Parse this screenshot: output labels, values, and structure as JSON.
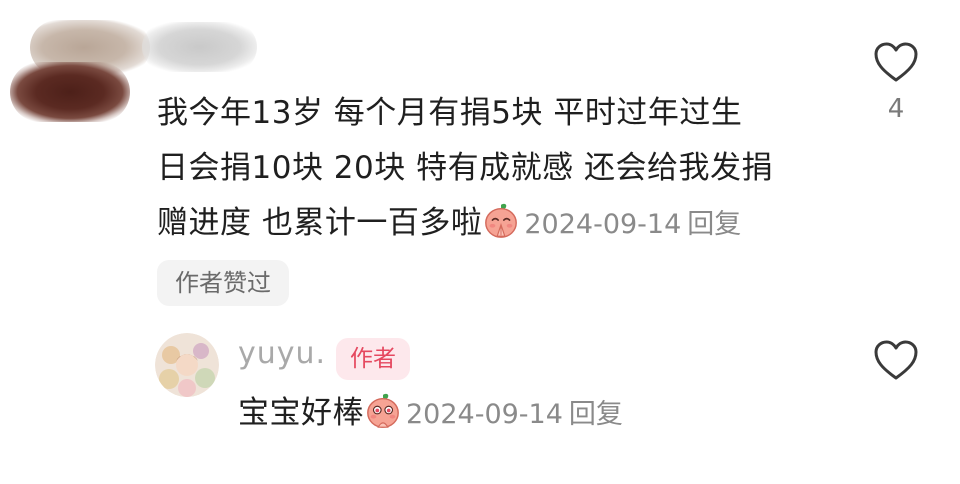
{
  "comment": {
    "text_line1": "我今年13岁 每个月有捐5块 平时过年过生",
    "text_line2": "日会捐10块 20块 特有成就感 还会给我发捐",
    "text_line3": "赠进度 也累计一百多啦",
    "emoji": "praying-face-emoji",
    "date": "2024-09-14",
    "reply_label": "回复",
    "liked_by_author": "作者赞过",
    "like_count": "4"
  },
  "reply": {
    "username": "yuyu.",
    "author_badge": "作者",
    "text": "宝宝好棒",
    "emoji": "teary-face-emoji",
    "date": "2024-09-14",
    "reply_label": "回复"
  },
  "colors": {
    "accent": "#e5485f",
    "badge_bg": "#fde8ec",
    "meta_gray": "#8a8a8a"
  }
}
